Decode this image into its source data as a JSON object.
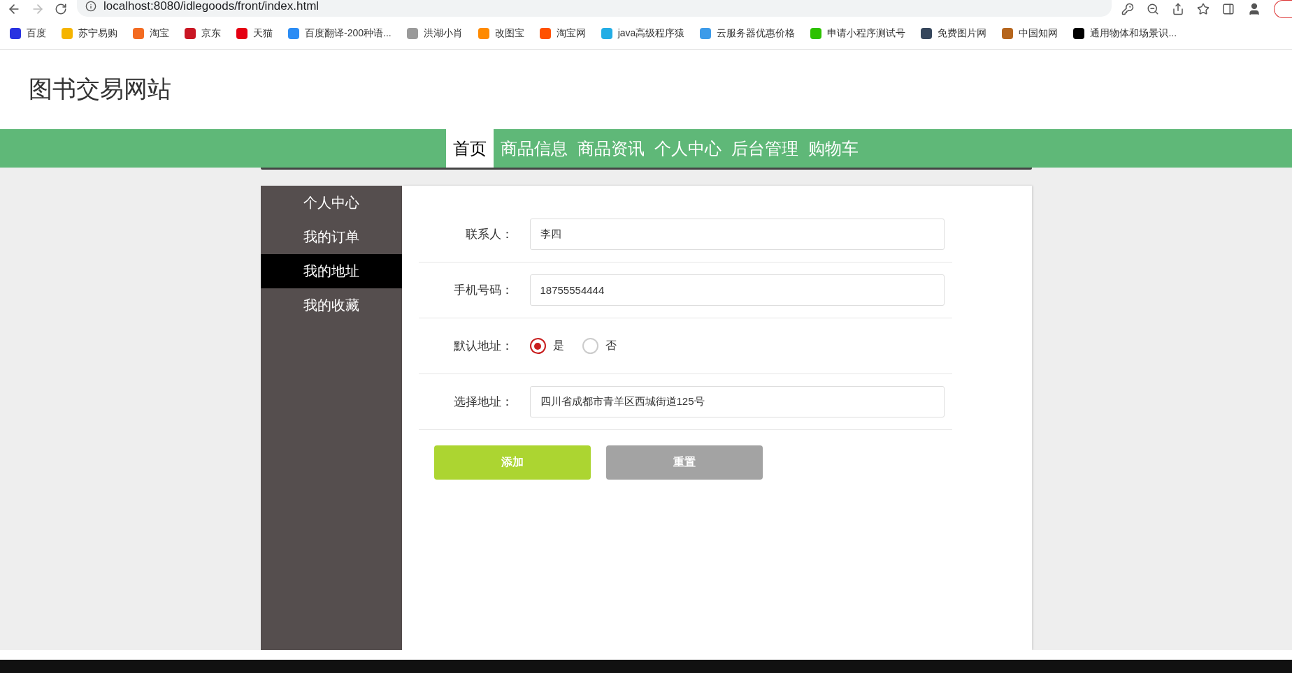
{
  "browser": {
    "address": "localhost:8080/idlegoods/front/index.html",
    "bookmarks": [
      {
        "label": "百度",
        "color": "#2932e1"
      },
      {
        "label": "苏宁易购",
        "color": "#f5b400"
      },
      {
        "label": "淘宝",
        "color": "#f36b21"
      },
      {
        "label": "京东",
        "color": "#c91623"
      },
      {
        "label": "天猫",
        "color": "#e50012"
      },
      {
        "label": "百度翻译-200种语...",
        "color": "#2b8cf4"
      },
      {
        "label": "洪湖小肖",
        "color": "#9a9a9a"
      },
      {
        "label": "改图宝",
        "color": "#ff8a00"
      },
      {
        "label": "淘宝网",
        "color": "#ff5000"
      },
      {
        "label": "java高级程序猿",
        "color": "#23ade5"
      },
      {
        "label": "云服务器优惠价格",
        "color": "#3d9be9"
      },
      {
        "label": "申请小程序测试号",
        "color": "#2dc100"
      },
      {
        "label": "免费图片网",
        "color": "#35465c"
      },
      {
        "label": "中国知网",
        "color": "#b5651d"
      },
      {
        "label": "通用物体和场景识...",
        "color": "#000000"
      }
    ]
  },
  "site": {
    "title": "图书交易网站"
  },
  "nav": [
    {
      "label": "首页",
      "selected": true
    },
    {
      "label": "商品信息",
      "selected": false
    },
    {
      "label": "商品资讯",
      "selected": false
    },
    {
      "label": "个人中心",
      "selected": false
    },
    {
      "label": "后台管理",
      "selected": false
    },
    {
      "label": "购物车",
      "selected": false
    }
  ],
  "sidebar": [
    {
      "label": "个人中心",
      "selected": false
    },
    {
      "label": "我的订单",
      "selected": false
    },
    {
      "label": "我的地址",
      "selected": true
    },
    {
      "label": "我的收藏",
      "selected": false
    }
  ],
  "form": {
    "fields": [
      {
        "kind": "text",
        "label": "联系人：",
        "value": "李四"
      },
      {
        "kind": "text",
        "label": "手机号码：",
        "value": "18755554444"
      },
      {
        "kind": "radio",
        "label": "默认地址：",
        "options": [
          {
            "label": "是",
            "selected": true
          },
          {
            "label": "否",
            "selected": false
          }
        ]
      },
      {
        "kind": "text",
        "label": "选择地址：",
        "value": "四川省成都市青羊区西城街道125号"
      }
    ],
    "buttons": [
      {
        "kind": "primary",
        "label": "添加"
      },
      {
        "kind": "secondary",
        "label": "重置"
      }
    ]
  }
}
